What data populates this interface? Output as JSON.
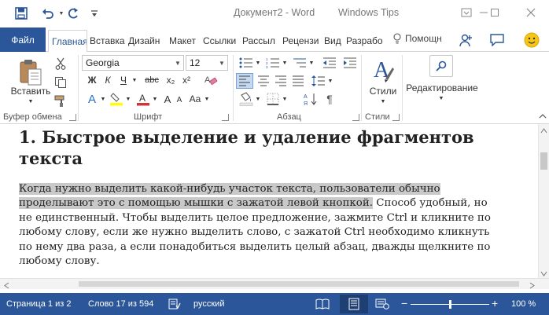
{
  "titlebar": {
    "document_title": "Документ2 - Word",
    "watermark": "Windows Tips",
    "icons": [
      "save-icon",
      "undo-icon",
      "redo-icon",
      "customize-qat-icon",
      "ribbon-display-icon",
      "minimize-icon",
      "maximize-icon",
      "close-icon"
    ]
  },
  "tabs": {
    "file": "Файл",
    "items": [
      "Главная",
      "Вставка",
      "Дизайн",
      "Макет",
      "Ссылки",
      "Рассыл",
      "Рецензи",
      "Вид",
      "Разрабо"
    ],
    "active": "Главная",
    "help": "Помощн"
  },
  "ribbon": {
    "clipboard": {
      "paste": "Вставить",
      "label": "Буфер обмена"
    },
    "font": {
      "name": "Georgia",
      "size": "12",
      "bold": "Ж",
      "italic": "К",
      "underline": "Ч",
      "strike": "abc",
      "subscript": "x₂",
      "superscript": "x²",
      "grow": "A",
      "shrink": "A",
      "case": "Aa",
      "label": "Шрифт"
    },
    "paragraph": {
      "label": "Абзац"
    },
    "styles": {
      "button": "Стили",
      "label": "Стили"
    },
    "editing": {
      "button": "Редактирование"
    }
  },
  "document": {
    "heading": "1. Быстрое выделение и удаление фрагментов текста",
    "selected_text": "Когда нужно выделить какой-нибудь участок текста, пользователи обычно проделывают это с помощью мышки с зажатой левой кнопкой.",
    "rest_text": " Способ удобный, но не единственный. Чтобы выделить целое предложение, зажмите Ctrl и кликните по любому слову, если же нужно выделить слово, с зажатой Ctrl необходимо кликнуть по нему два раза, а если понадобиться выделить целый абзац, дважды щелкните по любому слову."
  },
  "statusbar": {
    "page": "Страница 1 из 2",
    "words": "Слово 17 из 594",
    "language": "русский",
    "zoom": "100 %",
    "zoom_minus": "−",
    "zoom_plus": "+",
    "zoom_level": 1.0
  },
  "colors": {
    "accent": "#2b579a",
    "selection": "#c9c9c9",
    "highlight_yellow": "#ffff00",
    "font_red": "#d13438"
  }
}
